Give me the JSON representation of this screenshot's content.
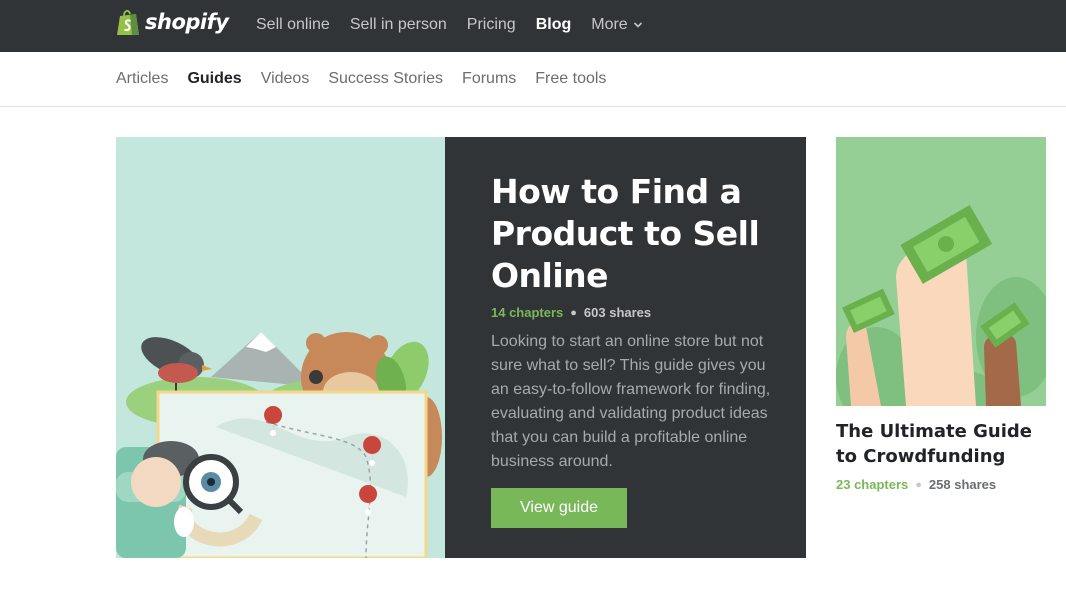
{
  "brand": {
    "name": "shopify"
  },
  "topnav": [
    {
      "label": "Sell online"
    },
    {
      "label": "Sell in person"
    },
    {
      "label": "Pricing"
    },
    {
      "label": "Blog"
    },
    {
      "label": "More"
    }
  ],
  "subnav": [
    {
      "label": "Articles"
    },
    {
      "label": "Guides"
    },
    {
      "label": "Videos"
    },
    {
      "label": "Success Stories"
    },
    {
      "label": "Forums"
    },
    {
      "label": "Free tools"
    }
  ],
  "featured": {
    "title": "How to Find a Product to Sell Online",
    "chapters": "14 chapters",
    "shares": "603 shares",
    "description": "Looking to start an online store but not sure what to sell? This guide gives you an easy-to-follow framework for finding, evaluating and validating product ideas that you can build a profitable online business around.",
    "button": "View guide"
  },
  "side": {
    "title": "The Ultimate Guide to Crowdfunding",
    "chapters": "23 chapters",
    "shares": "258 shares"
  },
  "colors": {
    "topbar": "#313436",
    "accent_green": "#79b859",
    "featured_bg": "#c3e6dd",
    "side_bg": "#96cf96"
  },
  "icons": [
    "shopify-bag-icon",
    "chevron-down-icon",
    "bullet-dot-icon"
  ]
}
